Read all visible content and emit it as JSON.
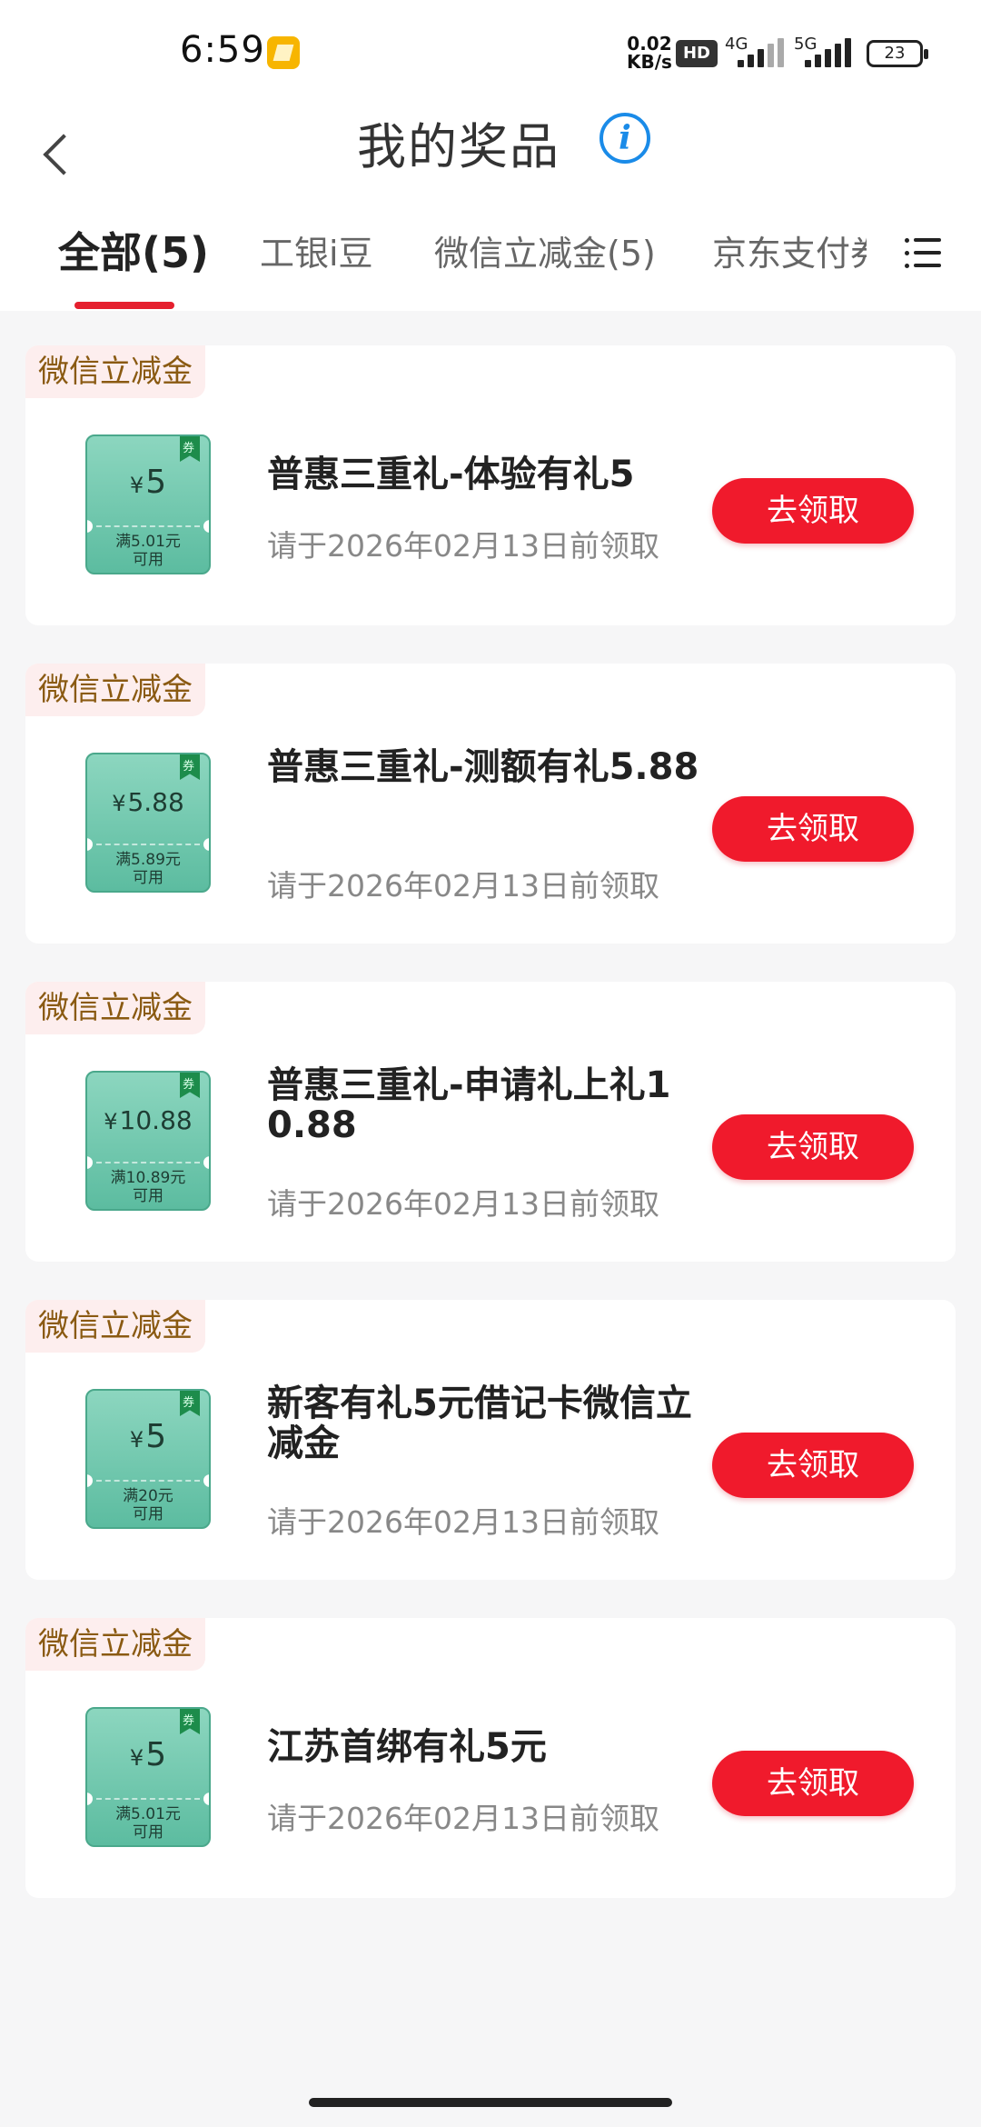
{
  "status_bar": {
    "time": "6:59",
    "net_speed_value": "0.02",
    "net_speed_unit": "KB/s",
    "hd_badge": "HD",
    "network_1": "4G",
    "network_2": "5G",
    "battery": "23"
  },
  "header": {
    "title": "我的奖品",
    "info_icon": "i"
  },
  "tabs": [
    {
      "label": "全部(5)",
      "active": true
    },
    {
      "label": "工银i豆",
      "active": false
    },
    {
      "label": "微信立减金(5)",
      "active": false
    },
    {
      "label": "京东支付券",
      "active": false
    }
  ],
  "colors": {
    "accent": "#e5202e",
    "button": "#f01a2c",
    "tag_text": "#8a5a12",
    "tag_bg": "#fdeeee",
    "coupon": "#5cbca0"
  },
  "prizes": [
    {
      "tag": "微信立减金",
      "currency": "¥",
      "amount": "5",
      "cond_line1": "满5.01元",
      "cond_line2": "可用",
      "title": "普惠三重礼-体验有礼5",
      "date": "请于2026年02月13日前领取",
      "button": "去领取"
    },
    {
      "tag": "微信立减金",
      "currency": "¥",
      "amount": "5.88",
      "cond_line1": "满5.89元",
      "cond_line2": "可用",
      "title": "普惠三重礼-测额有礼5.88",
      "date": "请于2026年02月13日前领取",
      "button": "去领取"
    },
    {
      "tag": "微信立减金",
      "currency": "¥",
      "amount": "10.88",
      "cond_line1": "满10.89元",
      "cond_line2": "可用",
      "title": "普惠三重礼-申请礼上礼10.88",
      "date": "请于2026年02月13日前领取",
      "button": "去领取"
    },
    {
      "tag": "微信立减金",
      "currency": "¥",
      "amount": "5",
      "cond_line1": "满20元",
      "cond_line2": "可用",
      "title": "新客有礼5元借记卡微信立减金",
      "date": "请于2026年02月13日前领取",
      "button": "去领取"
    },
    {
      "tag": "微信立减金",
      "currency": "¥",
      "amount": "5",
      "cond_line1": "满5.01元",
      "cond_line2": "可用",
      "title": "江苏首绑有礼5元",
      "date": "请于2026年02月13日前领取",
      "button": "去领取"
    }
  ]
}
